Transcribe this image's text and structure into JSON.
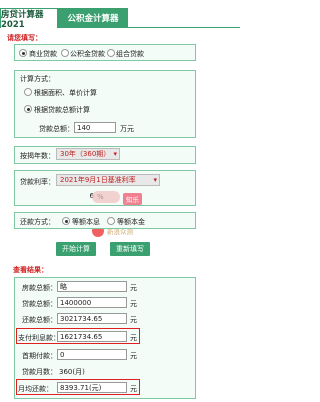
{
  "tabs": {
    "mortgage": "房贷计算器2021",
    "fund": "公积金计算器"
  },
  "section1": {
    "title": "请您填写：",
    "loan_types": [
      "商业贷款",
      "公积金贷款",
      "组合贷款"
    ]
  },
  "calc": {
    "title": "计算方式：",
    "opt1": "根据面积、单价计算",
    "opt2": "根据贷款总额计算",
    "total_label": "贷款总额：",
    "total_value": "140",
    "total_unit": "万元"
  },
  "term": {
    "label": "按揭年数：",
    "value": "30年（360期）"
  },
  "rate": {
    "label": "贷款利率：",
    "value": "2021年9月1日基准利率",
    "multiplier": "6",
    "pct": "%"
  },
  "repay": {
    "label": "还款方式：",
    "opt1": "等额本息",
    "opt2": "等额本金"
  },
  "buttons": {
    "start": "开始计算",
    "refill": "重新填写"
  },
  "watermark": {
    "text": "新浪众测",
    "tag": "知乐"
  },
  "results": {
    "title": "查看结果：",
    "rows": [
      {
        "label": "房款总额：",
        "value": "略",
        "unit": "元"
      },
      {
        "label": "贷款总额：",
        "value": "1400000",
        "unit": "元"
      },
      {
        "label": "还款总额：",
        "value": "3021734.65",
        "unit": "元"
      },
      {
        "label": "支付利息款：",
        "value": "1621734.65",
        "unit": "元"
      },
      {
        "label": "首期付款：",
        "value": "0",
        "unit": "元"
      },
      {
        "label": "贷款月数：",
        "value": "360(月)",
        "unit": ""
      },
      {
        "label": "月均还款：",
        "value": "8393.71(元)",
        "unit": "元"
      }
    ]
  }
}
